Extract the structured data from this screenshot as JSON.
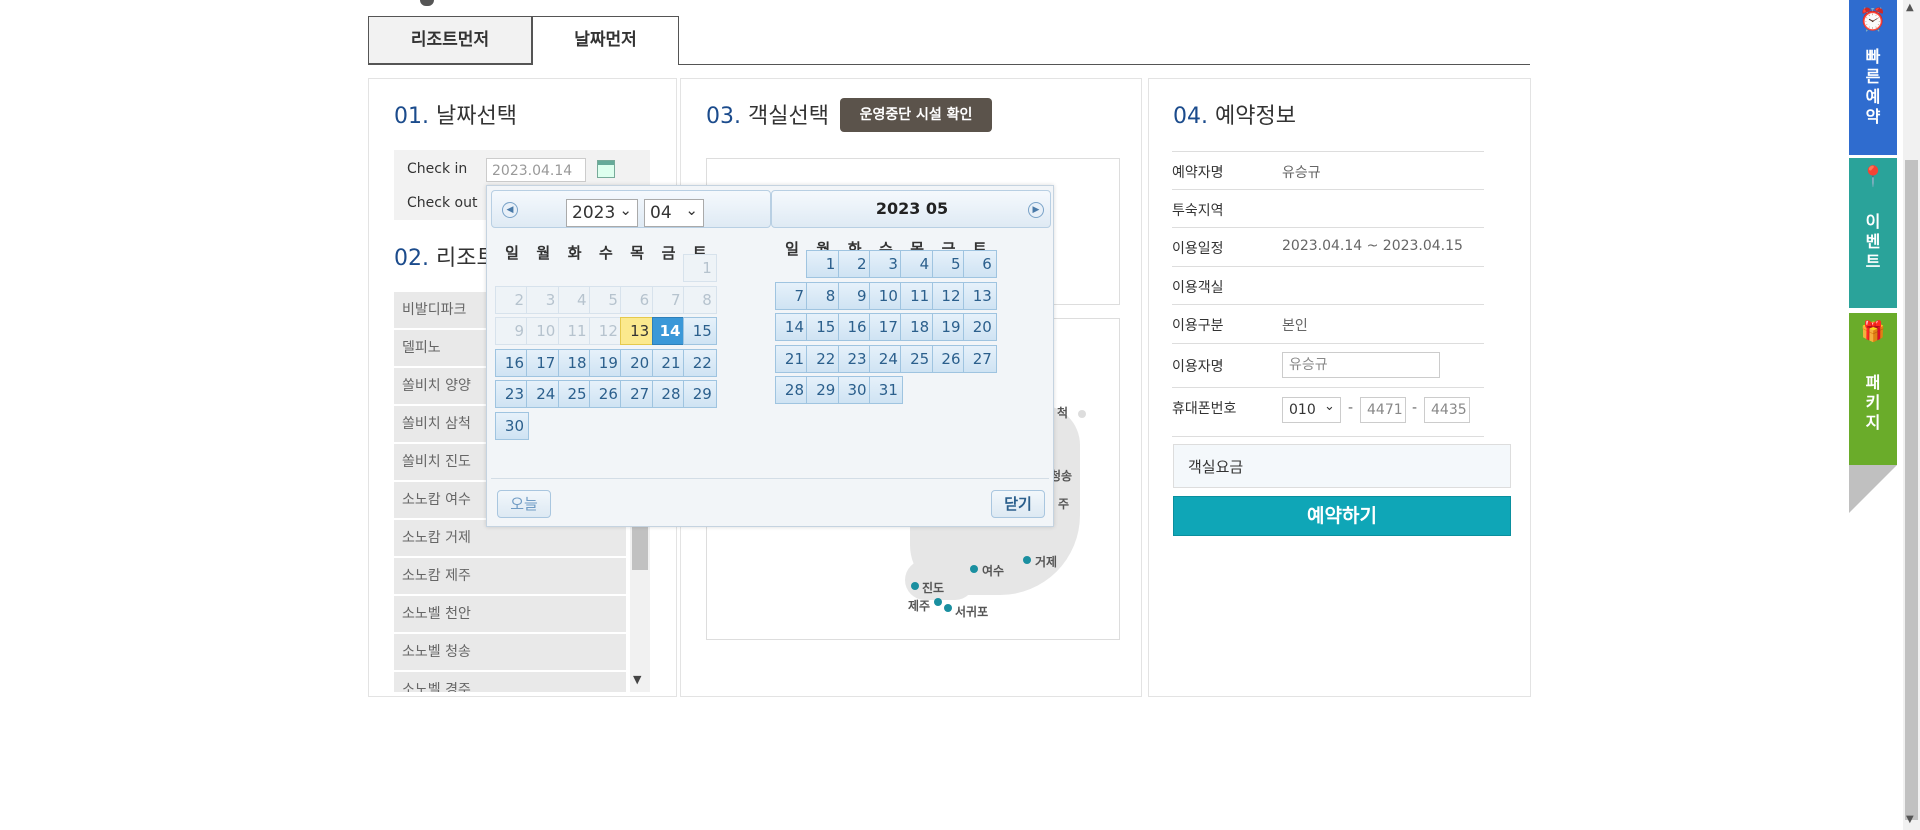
{
  "tabs": [
    "리조트먼저",
    "날짜먼저"
  ],
  "section1": {
    "num": "01.",
    "title": "날짜선택",
    "checkin_label": "Check in",
    "checkin_value": "2023.04.14",
    "checkout_label": "Check out"
  },
  "section2": {
    "num": "02.",
    "title": "리조트",
    "resorts": [
      "비발디파크",
      "델피노",
      "쏠비치 양양",
      "쏠비치 삼척",
      "쏠비치 진도",
      "소노캄 여수",
      "소노캄 거제",
      "소노캄 제주",
      "소노벨 천안",
      "소노벨 청송",
      "소노벨 경주"
    ]
  },
  "section3": {
    "num": "03.",
    "title": "객실선택",
    "warn_button": "운영중단 시설 확인",
    "map_labels": [
      "척",
      "청송",
      "주",
      "거제",
      "여수",
      "진도",
      "제주",
      "서귀포"
    ]
  },
  "section4": {
    "num": "04.",
    "title": "예약정보",
    "rows": [
      {
        "k": "예약자명",
        "v": "유승규"
      },
      {
        "k": "투숙지역",
        "v": ""
      },
      {
        "k": "이용일정",
        "v": "2023.04.14 ~ 2023.04.15"
      },
      {
        "k": "이용객실",
        "v": ""
      },
      {
        "k": "이용구분",
        "v": "본인"
      },
      {
        "k": "이용자명",
        "v": ""
      },
      {
        "k": "휴대폰번호",
        "v": ""
      }
    ],
    "user_name_value": "유승규",
    "phone": {
      "prefix": "010",
      "mid": "4471",
      "last": "4435",
      "dash": "-"
    },
    "fee_label": "객실요금",
    "reserve_button": "예약하기"
  },
  "datepicker": {
    "year_select": "2023",
    "month_select": "04",
    "right_title": "2023  05",
    "weekdays": [
      "일",
      "월",
      "화",
      "수",
      "목",
      "금",
      "토"
    ],
    "today_button": "오늘",
    "close_button": "닫기",
    "today_day": 13,
    "selected_day": 14
  },
  "side_menu": [
    {
      "label": "빠\n른\n예\n약",
      "color": "#2f6ccf",
      "icon": "alarm-clock-icon"
    },
    {
      "label": "이\n벤\n트",
      "color": "#2aa39a",
      "icon": "map-pin-icon"
    },
    {
      "label": "패\n키\n지",
      "color": "#6aac2a",
      "icon": "gift-icon"
    }
  ]
}
